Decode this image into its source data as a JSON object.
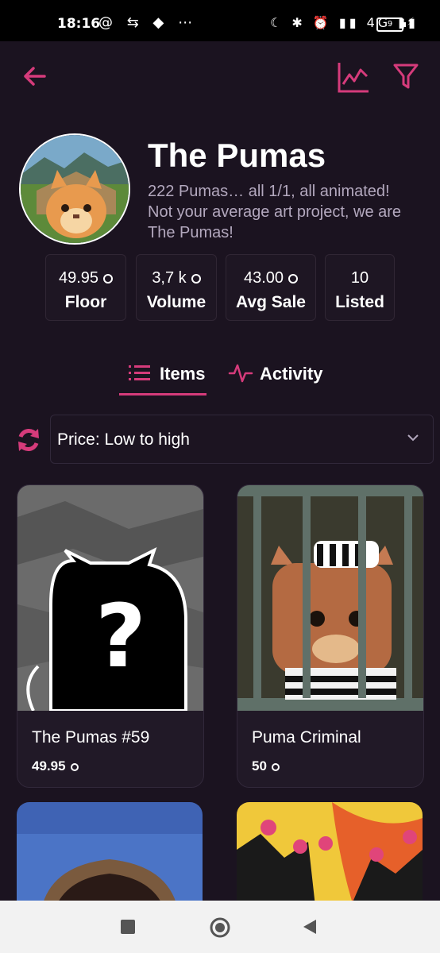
{
  "status_bar": {
    "time": "18:16",
    "left_icons": [
      "at-icon",
      "sync-icon",
      "discord-icon",
      "more-dots-icon"
    ],
    "left_glyphs": "@ ⇆ ◆ ⋯",
    "right_glyphs": "☾ ✱ ⏰ ▮▮ 4G ▮▮",
    "battery": "9"
  },
  "header": {
    "back_icon": "arrow-left-icon",
    "chart_icon": "line-chart-icon",
    "filter_icon": "filter-icon"
  },
  "collection": {
    "title": "The Pumas",
    "description": "222 Pumas… all 1/1, all animated!  Not your average art project, we are The Pumas!"
  },
  "stats": [
    {
      "value": "49.95",
      "label": "Floor",
      "sol": true
    },
    {
      "value": "3,7 k",
      "label": "Volume",
      "sol": true
    },
    {
      "value": "43.00",
      "label": "Avg Sale",
      "sol": true
    },
    {
      "value": "10",
      "label": "Listed",
      "sol": false
    }
  ],
  "tabs": [
    {
      "label": "Items",
      "icon": "list-icon",
      "active": true
    },
    {
      "label": "Activity",
      "icon": "activity-icon",
      "active": false
    }
  ],
  "sort": {
    "selected": "Price: Low to high",
    "refresh_icon": "refresh-icon"
  },
  "items": [
    {
      "name": "The Pumas #59",
      "price": "49.95"
    },
    {
      "name": "Puma Criminal",
      "price": "50"
    }
  ],
  "colors": {
    "accent": "#d63b7b",
    "background": "#1b1320",
    "card": "#211927",
    "muted_text": "#b3a8be"
  }
}
